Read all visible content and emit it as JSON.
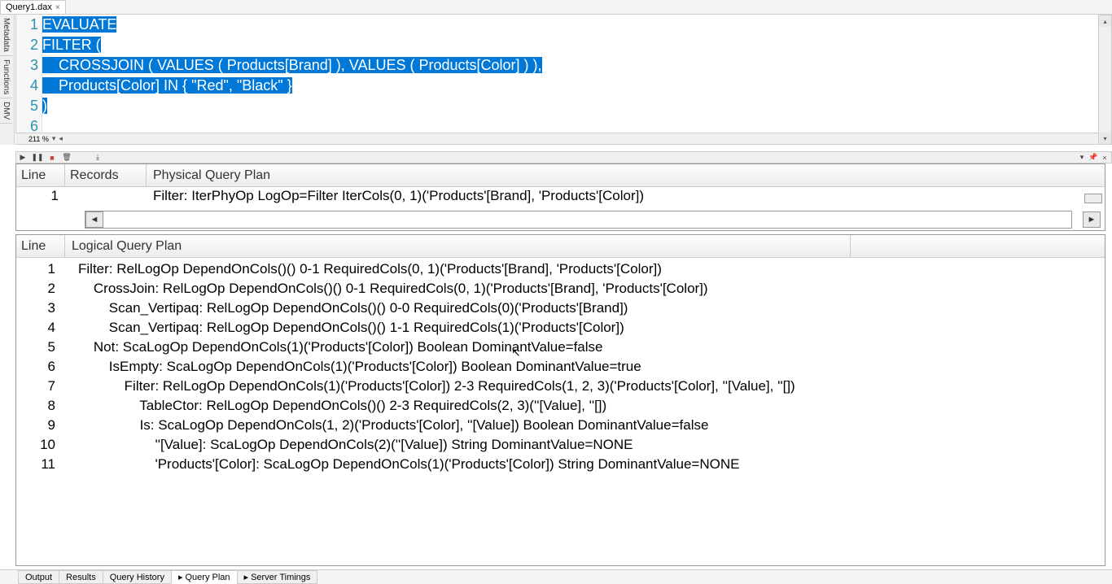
{
  "tab": {
    "title": "Query1.dax",
    "close": "×"
  },
  "side_tabs": [
    "Metadata",
    "Functions",
    "DMV"
  ],
  "editor": {
    "lines": [
      {
        "n": "1",
        "text": "EVALUATE"
      },
      {
        "n": "2",
        "text": "FILTER ("
      },
      {
        "n": "3",
        "text": "    CROSSJOIN ( VALUES ( Products[Brand] ), VALUES ( Products[Color] ) ),"
      },
      {
        "n": "4",
        "text": "    Products[Color] IN { \"Red\", \"Black\" }"
      },
      {
        "n": "5",
        "text": ")"
      },
      {
        "n": "6",
        "text": ""
      }
    ],
    "zoom": "211 %"
  },
  "toolbar_icons": {
    "play": "▶",
    "pause": "❚❚",
    "stop": "■",
    "clear": "🗑",
    "export": "⤓",
    "chevL": "◄",
    "chevR": "►",
    "dropdown": "▾",
    "pin": "📌",
    "close": "×"
  },
  "physical": {
    "headers": {
      "line": "Line",
      "records": "Records",
      "plan": "Physical Query Plan"
    },
    "rows": [
      {
        "line": "1",
        "records": "",
        "plan": "Filter: IterPhyOp LogOp=Filter IterCols(0, 1)('Products'[Brand], 'Products'[Color])"
      }
    ]
  },
  "logical": {
    "headers": {
      "line": "Line",
      "plan": "Logical Query Plan"
    },
    "rows": [
      {
        "line": "1",
        "indent": 0,
        "text": "Filter: RelLogOp DependOnCols()() 0-1 RequiredCols(0, 1)('Products'[Brand], 'Products'[Color])"
      },
      {
        "line": "2",
        "indent": 1,
        "text": "CrossJoin: RelLogOp DependOnCols()() 0-1 RequiredCols(0, 1)('Products'[Brand], 'Products'[Color])"
      },
      {
        "line": "3",
        "indent": 2,
        "text": "Scan_Vertipaq: RelLogOp DependOnCols()() 0-0 RequiredCols(0)('Products'[Brand])"
      },
      {
        "line": "4",
        "indent": 2,
        "text": "Scan_Vertipaq: RelLogOp DependOnCols()() 1-1 RequiredCols(1)('Products'[Color])"
      },
      {
        "line": "5",
        "indent": 1,
        "text": "Not: ScaLogOp DependOnCols(1)('Products'[Color]) Boolean DominantValue=false"
      },
      {
        "line": "6",
        "indent": 2,
        "text": "IsEmpty: ScaLogOp DependOnCols(1)('Products'[Color]) Boolean DominantValue=true"
      },
      {
        "line": "7",
        "indent": 3,
        "text": "Filter: RelLogOp DependOnCols(1)('Products'[Color]) 2-3 RequiredCols(1, 2, 3)('Products'[Color], ''[Value], ''[])"
      },
      {
        "line": "8",
        "indent": 4,
        "text": "TableCtor: RelLogOp DependOnCols()() 2-3 RequiredCols(2, 3)(''[Value], ''[])"
      },
      {
        "line": "9",
        "indent": 4,
        "text": "Is: ScaLogOp DependOnCols(1, 2)('Products'[Color], ''[Value]) Boolean DominantValue=false"
      },
      {
        "line": "10",
        "indent": 5,
        "text": "''[Value]: ScaLogOp DependOnCols(2)(''[Value]) String DominantValue=NONE"
      },
      {
        "line": "11",
        "indent": 5,
        "text": "'Products'[Color]: ScaLogOp DependOnCols(1)('Products'[Color]) String DominantValue=NONE"
      }
    ]
  },
  "status_tabs": [
    {
      "label": "Output",
      "marker": ""
    },
    {
      "label": "Results",
      "marker": ""
    },
    {
      "label": "Query History",
      "marker": ""
    },
    {
      "label": "Query Plan",
      "marker": "▸",
      "active": true
    },
    {
      "label": "Server Timings",
      "marker": "▸"
    }
  ]
}
